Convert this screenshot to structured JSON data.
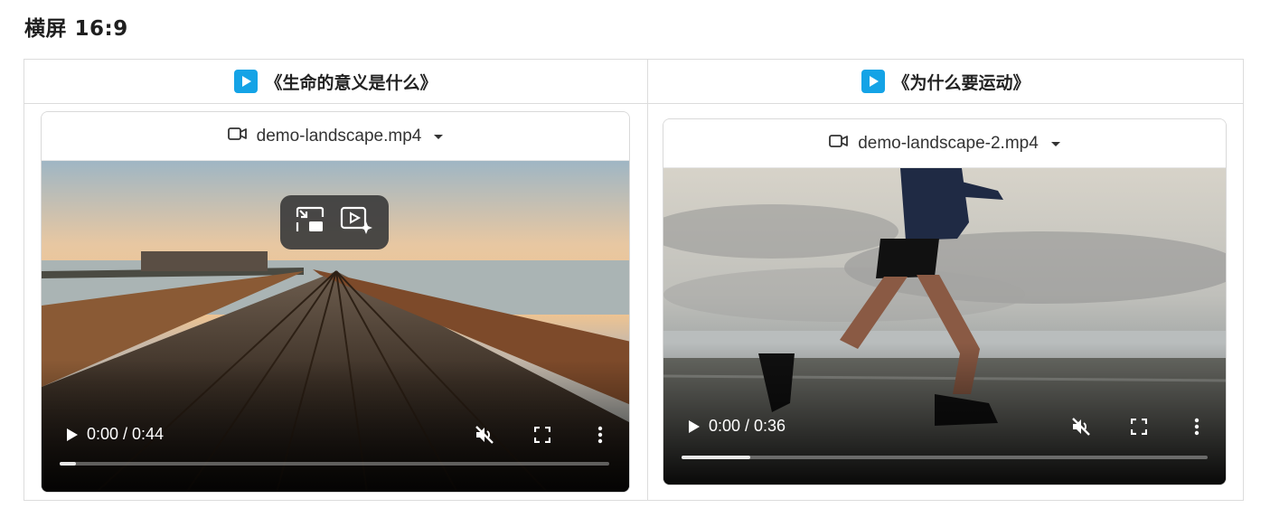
{
  "page": {
    "title": "横屏 16:9"
  },
  "columns": [
    {
      "header": "《生命的意义是什么》",
      "file_name": "demo-landscape.mp4",
      "time": "0:00 / 0:44",
      "progress_fraction": 0.03
    },
    {
      "header": "《为什么要运动》",
      "file_name": "demo-landscape-2.mp4",
      "time": "0:00 / 0:36",
      "progress_fraction": 0.13
    }
  ],
  "colors": {
    "accent": "#14a3e6",
    "border": "#dcdcdc"
  },
  "icons": [
    "play-badge-icon",
    "video-camera-icon",
    "caret-down-icon",
    "play-icon",
    "mute-icon",
    "fullscreen-icon",
    "more-icon",
    "exit-pip-icon",
    "auto-pip-icon"
  ]
}
